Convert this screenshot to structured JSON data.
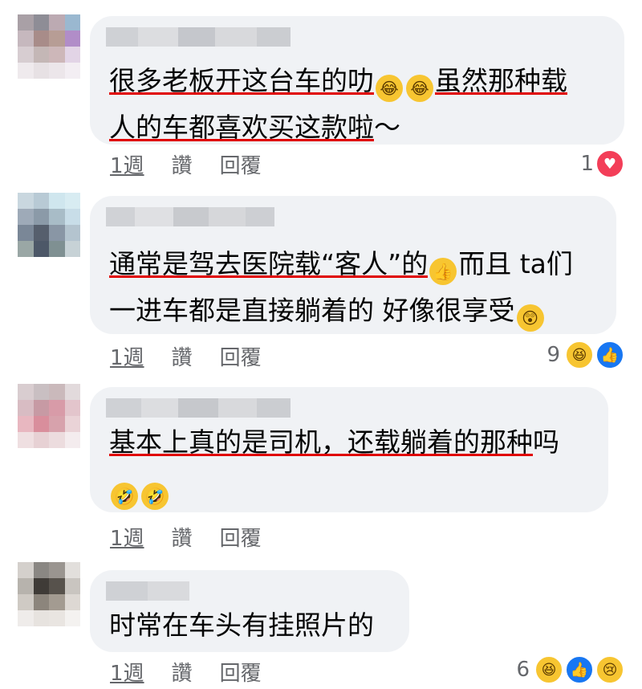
{
  "comments": [
    {
      "lines": [
        [
          {
            "t": "很多老板开这台车的叻",
            "u": true
          },
          {
            "emoji": "😂"
          },
          {
            "emoji": "😂"
          },
          {
            "t": "虽然那种载",
            "u": true
          }
        ],
        [
          {
            "t": "人的车都喜欢买这款啦",
            "u": true
          },
          {
            "t": "～",
            "u": false
          }
        ]
      ],
      "actions": {
        "time": "1週",
        "like": "讚",
        "reply": "回覆"
      },
      "reaction_count": "1",
      "reactions": [
        "love-icon"
      ]
    },
    {
      "lines": [
        [
          {
            "t": "通常是驾去医院载“客人”的",
            "u": true
          },
          {
            "emoji": "👍"
          },
          {
            "t": "而且 ta们",
            "u": false
          }
        ],
        [
          {
            "t": "一进车都是直接躺着的 好像很享受",
            "u": false
          },
          {
            "emoji": "😲"
          }
        ]
      ],
      "actions": {
        "time": "1週",
        "like": "讚",
        "reply": "回覆"
      },
      "reaction_count": "9",
      "reactions": [
        "haha-icon",
        "like-icon"
      ]
    },
    {
      "lines": [
        [
          {
            "t": "基本上真的是司机，还载躺着的那种",
            "u": true
          },
          {
            "t": "吗",
            "u": false
          }
        ],
        [
          {
            "emoji": "🤣"
          },
          {
            "emoji": "🤣"
          }
        ]
      ],
      "actions": {
        "time": "1週",
        "like": "讚",
        "reply": "回覆"
      },
      "reaction_count": "",
      "reactions": []
    },
    {
      "lines": [
        [
          {
            "t": "时常在车头有挂照片的",
            "u": false
          }
        ]
      ],
      "actions": {
        "time": "1週",
        "like": "讚",
        "reply": "回覆"
      },
      "reaction_count": "6",
      "reactions": [
        "haha-icon",
        "like-icon",
        "sad-icon"
      ]
    }
  ],
  "icons": {
    "love-icon": "♥",
    "like-icon": "👍",
    "haha-icon": "😆",
    "sad-icon": "😢"
  },
  "colors": {
    "bubble": "#f0f2f5",
    "underline": "#e00000",
    "meta": "#65676b",
    "like": "#1877f2",
    "love": "#f33e58"
  }
}
